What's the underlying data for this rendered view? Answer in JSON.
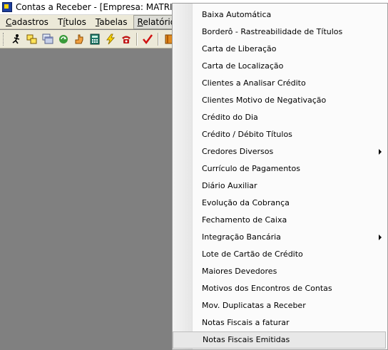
{
  "window": {
    "title": "Contas a Receber - [Empresa: MATRIZ - U"
  },
  "menubar": {
    "items": [
      {
        "label_u": "C",
        "label_rest": "adastros"
      },
      {
        "label_u": "",
        "label_pre": "T",
        "label_mid": "í",
        "label_rest": "tulos"
      },
      {
        "label_u": "T",
        "label_rest": "abelas"
      },
      {
        "label_u": "R",
        "label_rest": "elatórios"
      }
    ]
  },
  "toolbar": {
    "icons": [
      "exit-icon",
      "copy-icon",
      "windows-icon",
      "refresh-icon",
      "hand-icon",
      "calculator-icon",
      "lightning-icon",
      "phone-icon",
      "checkmark-icon",
      "book-icon"
    ]
  },
  "relatorios_menu": {
    "items": [
      {
        "label": "Baixa Automática",
        "submenu": false
      },
      {
        "label": "Borderô - Rastreabilidade de Títulos",
        "submenu": false
      },
      {
        "label": "Carta de Liberação",
        "submenu": false
      },
      {
        "label": "Carta de Localização",
        "submenu": false
      },
      {
        "label": "Clientes a Analisar Crédito",
        "submenu": false
      },
      {
        "label": "Clientes Motivo de Negativação",
        "submenu": false
      },
      {
        "label": "Crédito do Dia",
        "submenu": false
      },
      {
        "label": "Crédito / Débito Títulos",
        "submenu": false
      },
      {
        "label": "Credores Diversos",
        "submenu": true
      },
      {
        "label": "Currículo de Pagamentos",
        "submenu": false
      },
      {
        "label": "Diário Auxiliar",
        "submenu": false
      },
      {
        "label": "Evolução da Cobrança",
        "submenu": false
      },
      {
        "label": "Fechamento de Caixa",
        "submenu": false
      },
      {
        "label": "Integração Bancária",
        "submenu": true
      },
      {
        "label": "Lote de Cartão de Crédito",
        "submenu": false
      },
      {
        "label": "Maiores Devedores",
        "submenu": false
      },
      {
        "label": "Motivos dos Encontros de Contas",
        "submenu": false
      },
      {
        "label": "Mov. Duplicatas a Receber",
        "submenu": false
      },
      {
        "label": "Notas Fiscais a faturar",
        "submenu": false
      },
      {
        "label": "Notas Fiscais Emitidas",
        "submenu": false,
        "highlighted": true
      }
    ]
  }
}
